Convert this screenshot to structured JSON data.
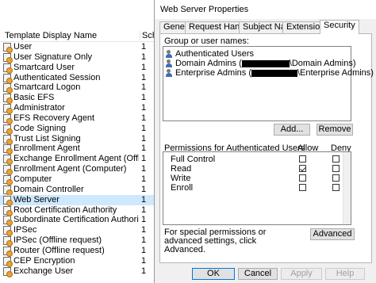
{
  "template_list": {
    "header": {
      "display_name": "Template Display Name",
      "schema": "Sche"
    },
    "rows": [
      {
        "name": "User",
        "ver": "1"
      },
      {
        "name": "User Signature Only",
        "ver": "1"
      },
      {
        "name": "Smartcard User",
        "ver": "1"
      },
      {
        "name": "Authenticated Session",
        "ver": "1"
      },
      {
        "name": "Smartcard Logon",
        "ver": "1"
      },
      {
        "name": "Basic EFS",
        "ver": "1"
      },
      {
        "name": "Administrator",
        "ver": "1"
      },
      {
        "name": "EFS Recovery Agent",
        "ver": "1"
      },
      {
        "name": "Code Signing",
        "ver": "1"
      },
      {
        "name": "Trust List Signing",
        "ver": "1"
      },
      {
        "name": "Enrollment Agent",
        "ver": "1"
      },
      {
        "name": "Exchange Enrollment Agent (Offline requ...",
        "ver": "1"
      },
      {
        "name": "Enrollment Agent (Computer)",
        "ver": "1"
      },
      {
        "name": "Computer",
        "ver": "1"
      },
      {
        "name": "Domain Controller",
        "ver": "1"
      },
      {
        "name": "Web Server",
        "ver": "1",
        "selected": true
      },
      {
        "name": "Root Certification Authority",
        "ver": "1"
      },
      {
        "name": "Subordinate Certification Authority",
        "ver": "1"
      },
      {
        "name": "IPSec",
        "ver": "1"
      },
      {
        "name": "IPSec (Offline request)",
        "ver": "1"
      },
      {
        "name": "Router (Offline request)",
        "ver": "1"
      },
      {
        "name": "CEP Encryption",
        "ver": "1"
      },
      {
        "name": "Exchange User",
        "ver": "1"
      }
    ]
  },
  "dialog": {
    "title": "Web Server Properties",
    "tabs": [
      {
        "label": "General"
      },
      {
        "label": "Request Handling"
      },
      {
        "label": "Subject Name"
      },
      {
        "label": "Extensions"
      },
      {
        "label": "Security",
        "active": true
      }
    ],
    "groups_label": "Group or user names:",
    "groups": [
      {
        "prefix": "Authenticated Users",
        "suffix": ""
      },
      {
        "prefix": "Domain Admins (",
        "suffix": "\\Domain Admins)"
      },
      {
        "prefix": "Enterprise Admins (",
        "suffix": "\\Enterprise Admins)"
      }
    ],
    "add_label": "Add...",
    "remove_label": "Remove",
    "permissions_label": "Permissions for Authenticated Users",
    "allow_label": "Allow",
    "deny_label": "Deny",
    "permissions": [
      {
        "name": "Full Control",
        "allow": false,
        "deny": false
      },
      {
        "name": "Read",
        "allow": true,
        "deny": false
      },
      {
        "name": "Write",
        "allow": false,
        "deny": false
      },
      {
        "name": "Enroll",
        "allow": false,
        "deny": false
      }
    ],
    "advanced_text": "For special permissions or advanced settings, click Advanced.",
    "advanced_label": "Advanced",
    "ok_label": "OK",
    "cancel_label": "Cancel",
    "apply_label": "Apply",
    "help_label": "Help"
  }
}
